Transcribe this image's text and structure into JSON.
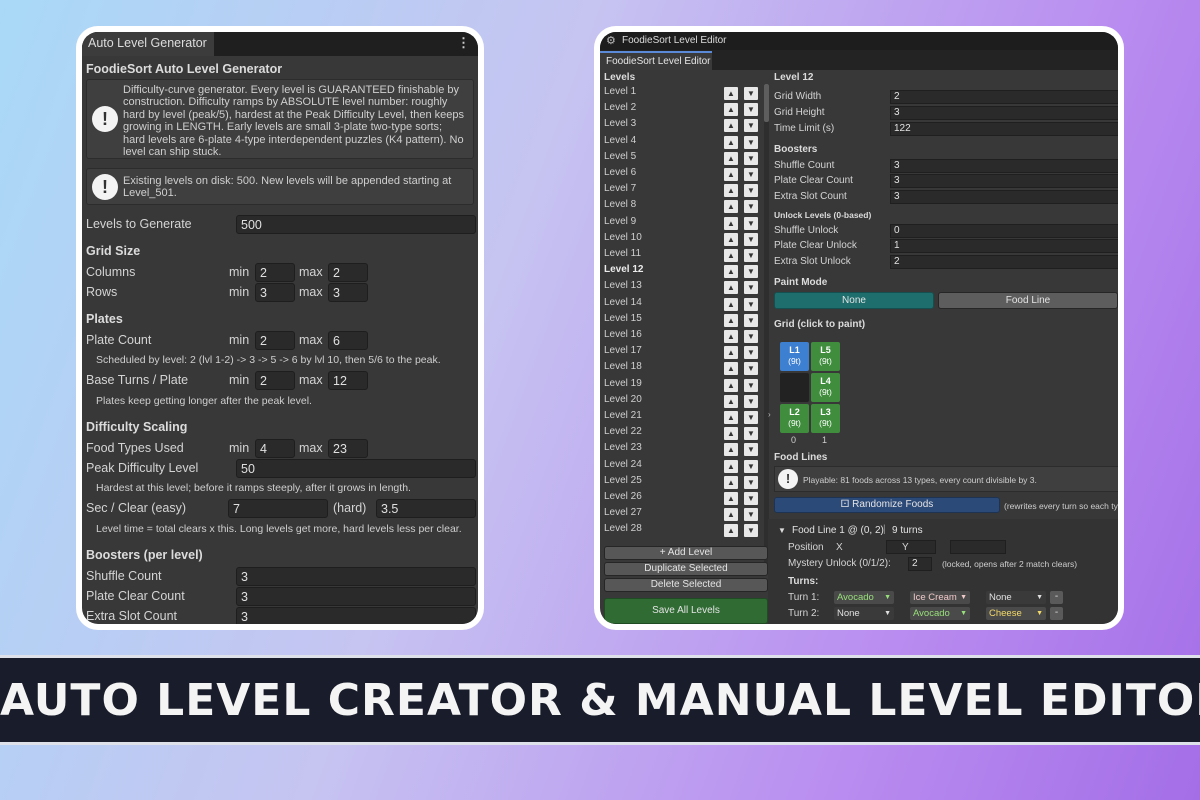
{
  "banner": {
    "text": "AUTO LEVEL CREATOR & MANUAL LEVEL EDITOR"
  },
  "left": {
    "tab": "Auto Level Generator",
    "kebab": "⋮",
    "title": "FoodieSort Auto Level Generator",
    "help1": "Difficulty-curve generator. Every level is GUARANTEED finishable by construction. Difficulty ramps by ABSOLUTE level number: roughly hard by level (peak/5), hardest at the Peak Difficulty Level, then keeps growing in LENGTH. Early levels are small 3-plate two-type sorts; hard levels are 6-plate 4-type interdependent puzzles (K4 pattern). No level can ship stuck.",
    "help2": "Existing levels on disk: 500. New levels will be appended starting at Level_501.",
    "levels_to_generate_label": "Levels to Generate",
    "levels_to_generate": "500",
    "grid_size": "Grid Size",
    "columns": "Columns",
    "rows": "Rows",
    "min": "min",
    "max": "max",
    "columns_min": "2",
    "columns_max": "2",
    "rows_min": "3",
    "rows_max": "3",
    "plates": "Plates",
    "plate_count": "Plate Count",
    "plate_min": "2",
    "plate_max": "6",
    "plate_note": "Scheduled by level: 2 (lvl 1-2) -> 3 -> 5 -> 6 by lvl 10, then 5/6 to the peak.",
    "base_turns": "Base Turns / Plate",
    "turns_min": "2",
    "turns_max": "12",
    "turns_note": "Plates keep getting longer after the peak level.",
    "difficulty_scaling": "Difficulty Scaling",
    "food_types": "Food Types Used",
    "food_min": "4",
    "food_max": "23",
    "peak_label": "Peak Difficulty Level",
    "peak_value": "50",
    "peak_note": "Hardest at this level; before it ramps steeply, after it grows in length.",
    "sec_clear": "Sec / Clear (easy)",
    "sec_easy": "7",
    "hard_label": "(hard)",
    "sec_hard": "3.5",
    "sec_note": "Level time = total clears x this. Long levels get more, hard levels less per clear.",
    "boosters": "Boosters (per level)",
    "shuffle": "Shuffle Count",
    "shuffle_val": "3",
    "plate_clear": "Plate Clear Count",
    "plate_clear_val": "3",
    "extra_slot": "Extra Slot Count",
    "extra_slot_val": "3"
  },
  "right": {
    "window_title": "FoodieSort Level Editor",
    "tab": "FoodieSort Level Editor",
    "levels_header": "Levels",
    "levels": [
      "Level 1",
      "Level 2",
      "Level 3",
      "Level 4",
      "Level 5",
      "Level 6",
      "Level 7",
      "Level 8",
      "Level 9",
      "Level 10",
      "Level 11",
      "Level 12",
      "Level 13",
      "Level 14",
      "Level 15",
      "Level 16",
      "Level 17",
      "Level 18",
      "Level 19",
      "Level 20",
      "Level 21",
      "Level 22",
      "Level 23",
      "Level 24",
      "Level 25",
      "Level 26",
      "Level 27",
      "Level 28"
    ],
    "selected_index": 11,
    "add_level": "+ Add Level",
    "duplicate": "Duplicate Selected",
    "delete": "Delete Selected",
    "save_all": "Save All Levels",
    "level_title": "Level 12",
    "grid_width_label": "Grid Width",
    "grid_width": "2",
    "grid_height_label": "Grid Height",
    "grid_height": "3",
    "time_limit_label": "Time Limit (s)",
    "time_limit": "122",
    "boosters_header": "Boosters",
    "shuffle_count_label": "Shuffle Count",
    "shuffle_count": "3",
    "plate_clear_label": "Plate Clear Count",
    "plate_clear": "3",
    "extra_slot_label": "Extra Slot Count",
    "extra_slot": "3",
    "unlock_header": "Unlock Levels (0-based)",
    "shuffle_unlock_label": "Shuffle Unlock",
    "shuffle_unlock": "0",
    "plate_clear_unlock_label": "Plate Clear Unlock",
    "plate_clear_unlock": "1",
    "extra_slot_unlock_label": "Extra Slot Unlock",
    "extra_slot_unlock": "2",
    "paint_mode_header": "Paint Mode",
    "paint_none": "None",
    "paint_food_line": "Food Line",
    "grid_header": "Grid (click to paint)",
    "cells": [
      {
        "label": "L1",
        "turns": "(9t)",
        "color": "#3d7fd1"
      },
      {
        "label": "L5",
        "turns": "(9t)",
        "color": "#3f8d3d"
      },
      {
        "label": "",
        "turns": "",
        "color": "#222222"
      },
      {
        "label": "L4",
        "turns": "(9t)",
        "color": "#3f8d3d"
      },
      {
        "label": "L2",
        "turns": "(9t)",
        "color": "#3f8d3d"
      },
      {
        "label": "L3",
        "turns": "(9t)",
        "color": "#3f8d3d"
      }
    ],
    "col_labels": [
      "0",
      "1"
    ],
    "food_lines_header": "Food Lines",
    "playable_note": "Playable: 81 foods across 13 types, every count divisible by 3.",
    "randomize": "Randomize Foods",
    "randomize_note": "(rewrites every turn so each typ",
    "food_line_title": "Food Line 1 @ (0, 2)",
    "food_line_turns": "9 turns",
    "position_label": "Position",
    "x_label": "X",
    "y_label": "Y",
    "mystery_label": "Mystery Unlock (0/1/2):",
    "mystery_value": "2",
    "mystery_note": "(locked, opens after 2 match clears)",
    "turns_header": "Turns:",
    "turn1_label": "Turn 1:",
    "turn2_label": "Turn 2:",
    "turn1": [
      {
        "text": "Avocado",
        "color": "#98e07a"
      },
      {
        "text": "Ice Cream",
        "color": "#f0c9c9"
      },
      {
        "text": "None",
        "color": "#e0e0e0"
      }
    ],
    "turn2": [
      {
        "text": "None",
        "color": "#e0e0e0"
      },
      {
        "text": "Avocado",
        "color": "#98e07a"
      },
      {
        "text": "Cheese",
        "color": "#f3d96a"
      }
    ],
    "minus": "-"
  }
}
